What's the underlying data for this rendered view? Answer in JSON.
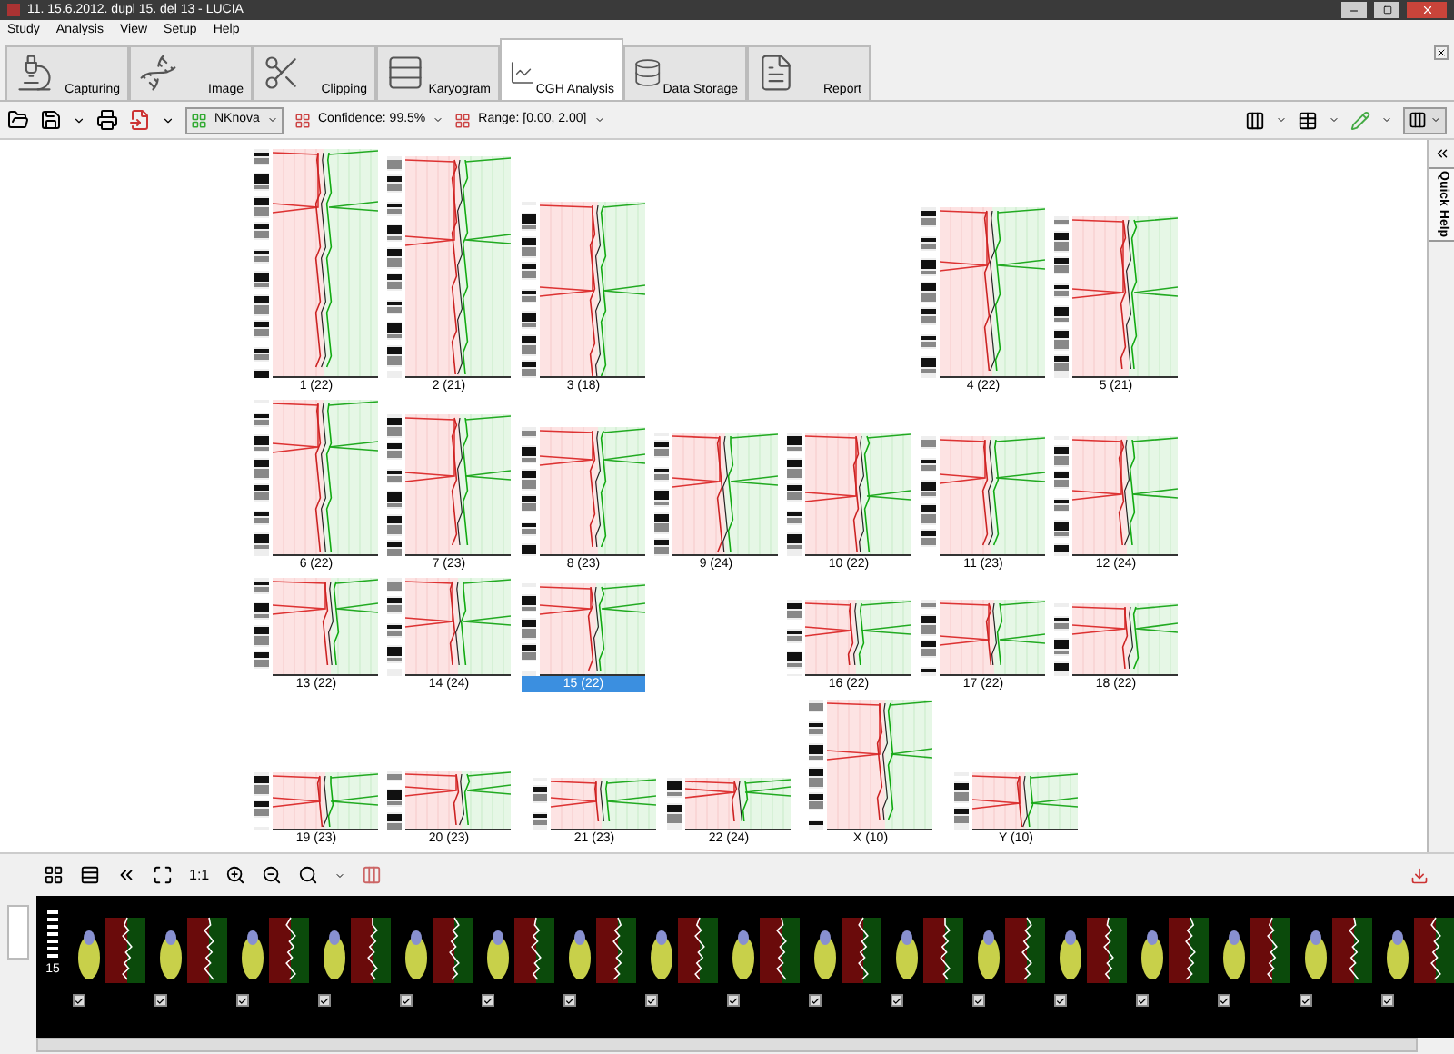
{
  "window": {
    "title": "11. 15.6.2012. dupl 15. del 13 - LUCIA"
  },
  "menu": [
    "Study",
    "Analysis",
    "View",
    "Setup",
    "Help"
  ],
  "tabs": [
    {
      "label": "Capturing",
      "selected": false
    },
    {
      "label": "Image",
      "selected": false
    },
    {
      "label": "Clipping",
      "selected": false
    },
    {
      "label": "Karyogram",
      "selected": false
    },
    {
      "label": "CGH Analysis",
      "selected": true
    },
    {
      "label": "Data Storage",
      "selected": false
    },
    {
      "label": "Report",
      "selected": false
    }
  ],
  "toolbar": {
    "profile": "NKnova",
    "confidence": "Confidence: 99.5%",
    "range": "Range: [0.00, 2.00]"
  },
  "quick_help": {
    "label": "Quick Help"
  },
  "chromosomes": [
    {
      "label": "1 (22)",
      "selected": false
    },
    {
      "label": "2 (21)",
      "selected": false
    },
    {
      "label": "3 (18)",
      "selected": false
    },
    {
      "label": "4 (22)",
      "selected": false
    },
    {
      "label": "5 (21)",
      "selected": false
    },
    {
      "label": "6 (22)",
      "selected": false
    },
    {
      "label": "7 (23)",
      "selected": false
    },
    {
      "label": "8 (23)",
      "selected": false
    },
    {
      "label": "9 (24)",
      "selected": false
    },
    {
      "label": "10 (22)",
      "selected": false
    },
    {
      "label": "11 (23)",
      "selected": false
    },
    {
      "label": "12 (24)",
      "selected": false
    },
    {
      "label": "13 (22)",
      "selected": false
    },
    {
      "label": "14 (24)",
      "selected": false
    },
    {
      "label": "15 (22)",
      "selected": true
    },
    {
      "label": "16 (22)",
      "selected": false
    },
    {
      "label": "17 (22)",
      "selected": false
    },
    {
      "label": "18 (22)",
      "selected": false
    },
    {
      "label": "19 (23)",
      "selected": false
    },
    {
      "label": "20 (23)",
      "selected": false
    },
    {
      "label": "21 (23)",
      "selected": false
    },
    {
      "label": "22 (24)",
      "selected": false
    },
    {
      "label": "X (10)",
      "selected": false
    },
    {
      "label": "Y (10)",
      "selected": false
    }
  ],
  "bottom_toolbar": {
    "zoom_actual": "1:1"
  },
  "strip": {
    "chromosome_number": "15",
    "thumbnails": [
      {
        "checked": true
      },
      {
        "checked": true
      },
      {
        "checked": true
      },
      {
        "checked": true
      },
      {
        "checked": true
      },
      {
        "checked": true
      },
      {
        "checked": true
      },
      {
        "checked": true
      },
      {
        "checked": true
      },
      {
        "checked": true
      },
      {
        "checked": true
      },
      {
        "checked": true
      },
      {
        "checked": true
      },
      {
        "checked": true
      },
      {
        "checked": true
      },
      {
        "checked": true
      },
      {
        "checked": true
      }
    ]
  }
}
